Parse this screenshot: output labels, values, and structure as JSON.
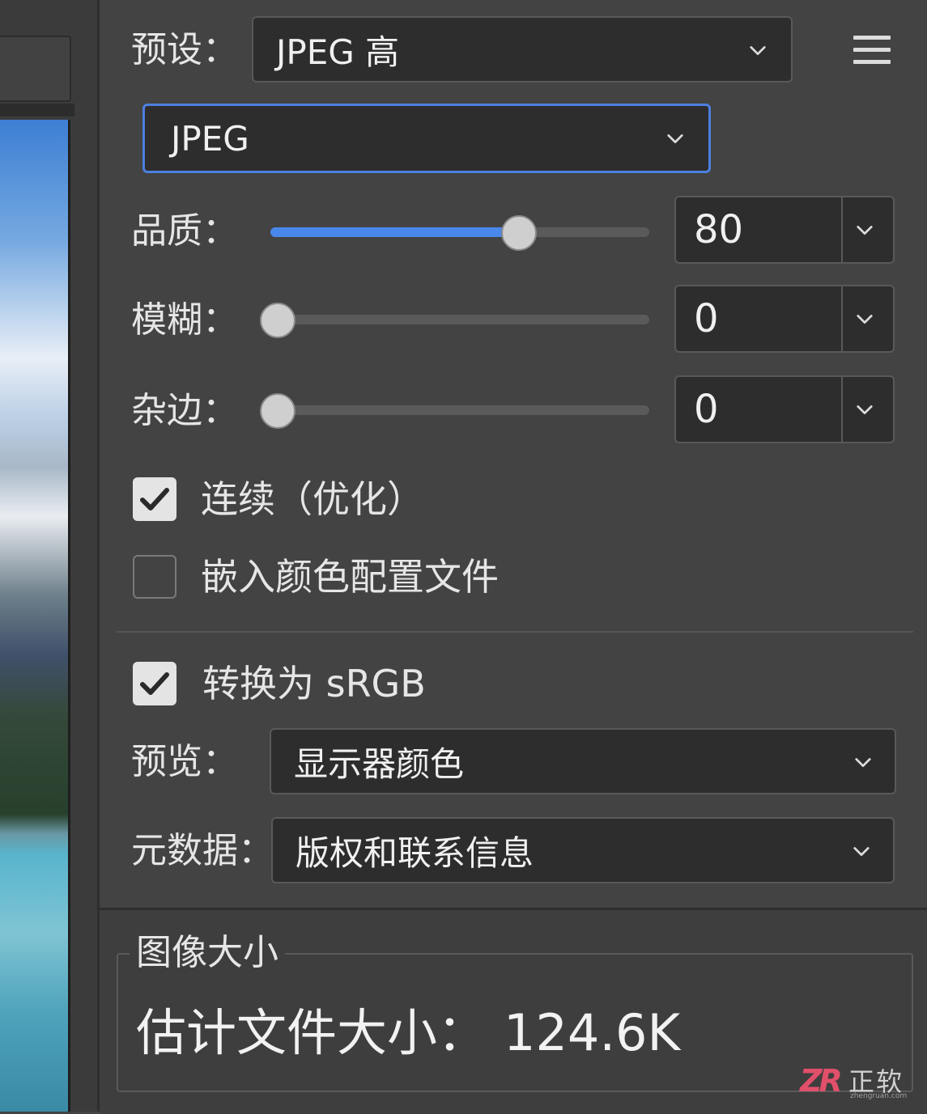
{
  "preset": {
    "label": "预设：",
    "value": "JPEG 高"
  },
  "format": {
    "value": "JPEG"
  },
  "quality": {
    "label": "品质：",
    "value": "80",
    "level": 0.66
  },
  "blur": {
    "label": "模糊：",
    "value": "0",
    "level": 0
  },
  "matte": {
    "label": "杂边：",
    "value": "0",
    "level": 0
  },
  "progressive": {
    "label": "连续（优化）",
    "checked": true
  },
  "embed_profile": {
    "label": "嵌入颜色配置文件",
    "checked": false
  },
  "convert_srgb": {
    "label": "转换为 sRGB",
    "checked": true
  },
  "preview": {
    "label": "预览：",
    "value": "显示器颜色"
  },
  "metadata": {
    "label": "元数据：",
    "value": "版权和联系信息"
  },
  "image_size": {
    "legend": "图像大小",
    "estimate_label": "估计文件大小：",
    "estimate_value": "124.6K"
  },
  "watermark": {
    "logo": "ZR",
    "text": "正软",
    "sub": "zhengruan.com"
  },
  "colors": {
    "accent": "#4a87ec",
    "panel": "#434343",
    "field": "#2d2d2d",
    "focus_border": "#4c7fe0"
  },
  "icons": {
    "menu": "hamburger-menu-icon",
    "dropdown": "chevron-down-icon",
    "check": "checkmark-icon"
  }
}
